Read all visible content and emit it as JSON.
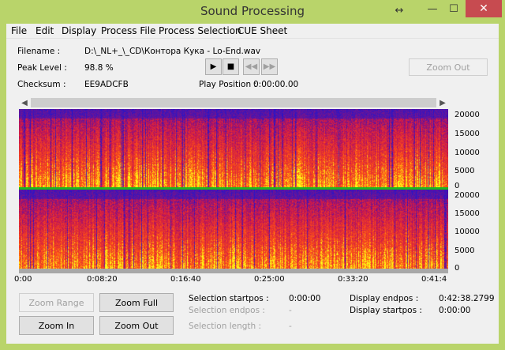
{
  "window": {
    "title": "Sound Processing",
    "close_glyph": "✕",
    "maximize_glyph": "☐",
    "minimize_glyph": "—",
    "resize_glyph": "↔"
  },
  "menu": [
    "File",
    "Edit",
    "Display",
    "Process File",
    "Process Selection",
    "CUE Sheet"
  ],
  "info": {
    "filename_label": "Filename :",
    "filename_value": "D:\\_NL+_\\_CD\\Контора Кука - Lo-End.wav",
    "peak_label": "Peak Level :",
    "peak_value": "98.8 %",
    "checksum_label": "Checksum :",
    "checksum_value": "EE9ADCFB",
    "play_position_label": "Play Position :",
    "play_position_value": "0:00:00.00"
  },
  "transport": {
    "play": "▶",
    "stop": "■",
    "rewind": "◀◀",
    "forward": "▶▶"
  },
  "zoom_out_top": "Zoom Out",
  "spectrogram": {
    "y_ticks_top": [
      "20000",
      "15000",
      "10000",
      "5000",
      "0"
    ],
    "y_ticks_bottom": [
      "20000",
      "15000",
      "10000",
      "5000",
      "0"
    ],
    "x_ticks": [
      "0:00",
      "0:08:20",
      "0:16:40",
      "0:25:00",
      "0:33:20",
      "0:41:4"
    ],
    "colors": {
      "low": "#1a1acc",
      "mid": "#d41a1a",
      "high": "#ffd400",
      "divider": "#1fb61f"
    }
  },
  "buttons": {
    "zoom_range": "Zoom Range",
    "zoom_full": "Zoom Full",
    "zoom_in": "Zoom In",
    "zoom_out": "Zoom Out"
  },
  "selection": {
    "startpos_label": "Selection startpos :",
    "startpos_value": "0:00:00",
    "endpos_label": "Selection endpos :",
    "endpos_value": "-",
    "length_label": "Selection length :",
    "length_value": "-"
  },
  "display": {
    "endpos_label": "Display endpos :",
    "endpos_value": "0:42:38.2799",
    "startpos_label": "Display startpos :",
    "startpos_value": "0:00:00"
  }
}
